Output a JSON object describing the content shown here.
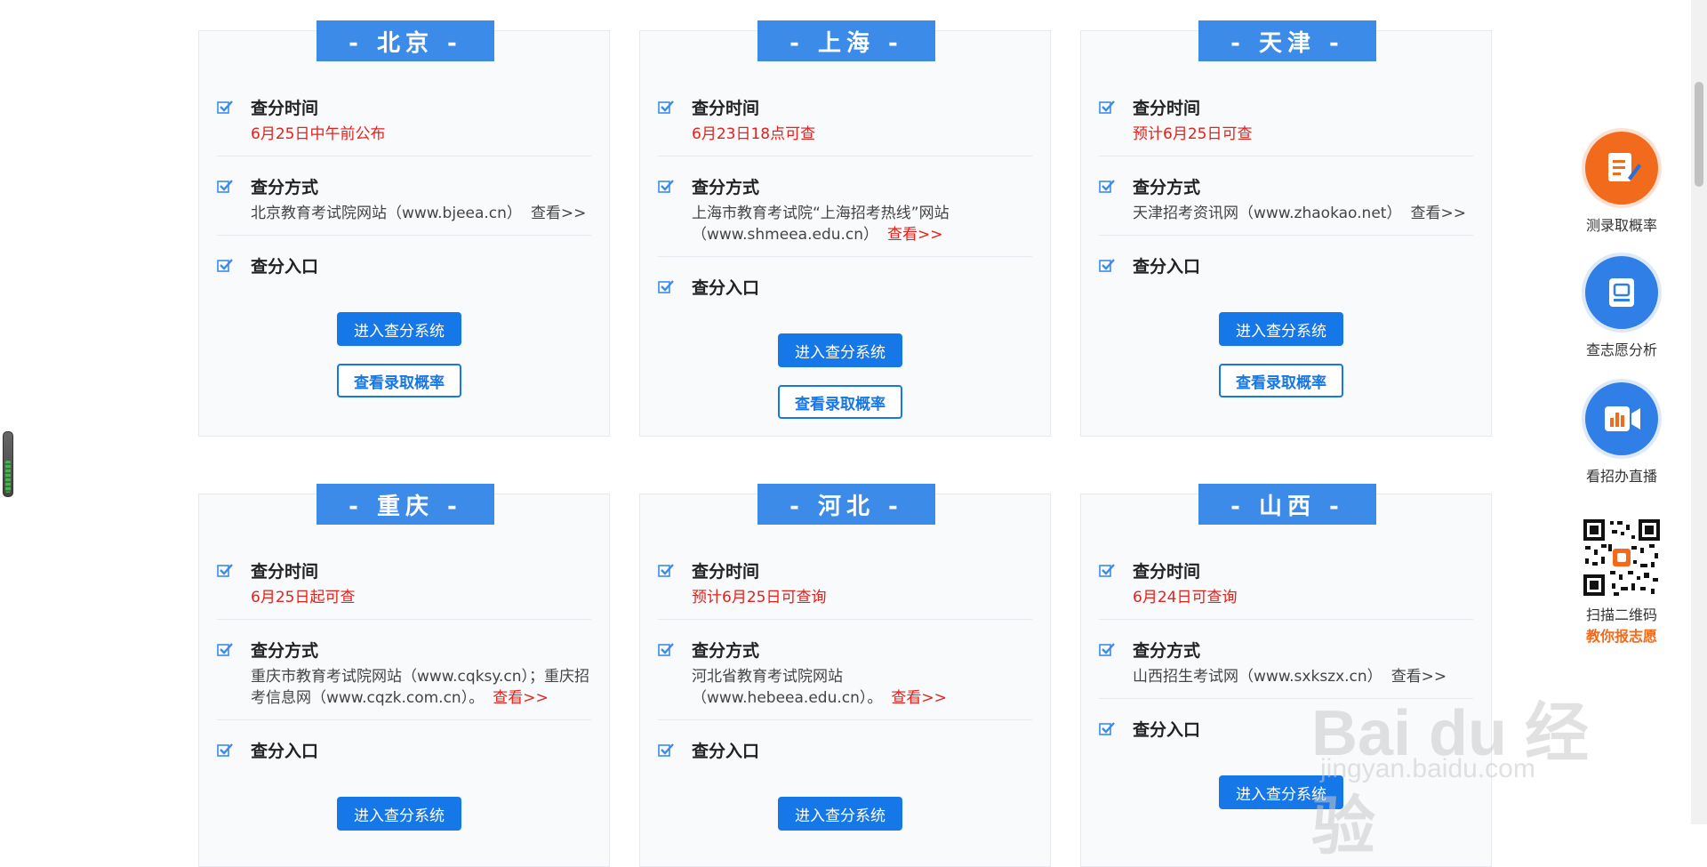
{
  "cards": [
    {
      "region": "- 北京 -",
      "time_label": "查分时间",
      "time_value": "6月25日中午前公布",
      "method_label": "查分方式",
      "method_text": "北京教育考试院网站（www.bjeea.cn）",
      "method_link": "查看>>",
      "entry_label": "查分入口",
      "btn_primary": "进入查分系统",
      "btn_secondary": "查看录取概率"
    },
    {
      "region": "- 上海 -",
      "time_label": "查分时间",
      "time_value": "6月23日18点可查",
      "method_label": "查分方式",
      "method_text": "上海市教育考试院“上海招考热线”网站（www.shmeea.edu.cn）",
      "method_link": "查看>>",
      "entry_label": "查分入口",
      "btn_primary": "进入查分系统",
      "btn_secondary": "查看录取概率"
    },
    {
      "region": "- 天津 -",
      "time_label": "查分时间",
      "time_value": "预计6月25日可查",
      "method_label": "查分方式",
      "method_text": "天津招考资讯网（www.zhaokao.net）",
      "method_link": "查看>>",
      "entry_label": "查分入口",
      "btn_primary": "进入查分系统",
      "btn_secondary": "查看录取概率"
    },
    {
      "region": "- 重庆 -",
      "time_label": "查分时间",
      "time_value": "6月25日起可查",
      "method_label": "查分方式",
      "method_text": "重庆市教育考试院网站（www.cqksy.cn）；重庆招考信息网（www.cqzk.com.cn）。",
      "method_link": "查看>>",
      "entry_label": "查分入口",
      "btn_primary": "进入查分系统"
    },
    {
      "region": "- 河北 -",
      "time_label": "查分时间",
      "time_value": "预计6月25日可查询",
      "method_label": "查分方式",
      "method_text": "河北省教育考试院网站（www.hebeea.edu.cn）。",
      "method_link": "查看>>",
      "entry_label": "查分入口",
      "btn_primary": "进入查分系统"
    },
    {
      "region": "- 山西 -",
      "time_label": "查分时间",
      "time_value": "6月24日可查询",
      "method_label": "查分方式",
      "method_text": "山西招生考试网（www.sxkszx.cn）",
      "method_link": "查看>>",
      "entry_label": "查分入口",
      "btn_primary": "进入查分系统"
    }
  ],
  "sidebar": {
    "items": [
      {
        "label": "测录取概率",
        "icon": "document-pen-icon"
      },
      {
        "label": "查志愿分析",
        "icon": "clipboard-icon"
      },
      {
        "label": "看招办直播",
        "icon": "video-chart-icon"
      }
    ],
    "qr_line1": "扫描二维码",
    "qr_line2": "教你报志愿"
  },
  "watermark": {
    "main": "Bai du 经验",
    "sub": "jingyan.baidu.com"
  },
  "colors": {
    "accent": "#3d8be8",
    "button": "#1677e8",
    "red": "#e4211a",
    "orange": "#f26a1b"
  }
}
